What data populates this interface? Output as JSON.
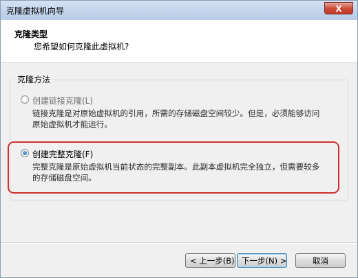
{
  "window": {
    "title": "克隆虚拟机向导",
    "close_symbol": "X"
  },
  "header": {
    "title": "克隆类型",
    "subtitle": "您希望如何克隆此虚拟机?"
  },
  "group": {
    "label": "克隆方法"
  },
  "options": [
    {
      "label": "创建链接克隆(L)",
      "description": "链接克隆是对原始虚拟机的引用，所需的存储磁盘空间较少。但是，必须能够访问原始虚拟机才能运行。",
      "selected": false
    },
    {
      "label": "创建完整克隆(F)",
      "description": "完整克隆是原始虚拟机当前状态的完整副本。此副本虚拟机完全独立，但需要较多的存储磁盘空间。",
      "selected": true
    }
  ],
  "annotation": {
    "color": "#d03030"
  },
  "buttons": {
    "back": "< 上一步(B)",
    "next": "下一步(N) >",
    "cancel": "取消"
  },
  "colors": {
    "accent": "#1a62b6",
    "close": "#c23b26"
  }
}
